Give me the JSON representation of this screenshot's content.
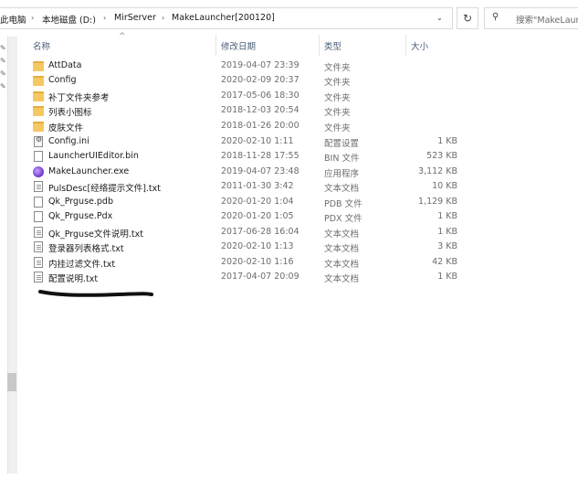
{
  "address": {
    "breadcrumbs": [
      "此电脑",
      "本地磁盘 (D:)",
      "MirServer",
      "MakeLauncher[200120]"
    ]
  },
  "search": {
    "placeholder": "搜索\"MakeLauncher\""
  },
  "columns": {
    "name": "名称",
    "date": "修改日期",
    "type": "类型",
    "size": "大小"
  },
  "files": [
    {
      "name": "AttData",
      "date": "2019-04-07 23:39",
      "type": "文件夹",
      "size": "",
      "icon": "folder-icon"
    },
    {
      "name": "Config",
      "date": "2020-02-09 20:37",
      "type": "文件夹",
      "size": "",
      "icon": "folder-icon"
    },
    {
      "name": "补丁文件夹参考",
      "date": "2017-05-06 18:30",
      "type": "文件夹",
      "size": "",
      "icon": "folder-icon"
    },
    {
      "name": "列表小图标",
      "date": "2018-12-03 20:54",
      "type": "文件夹",
      "size": "",
      "icon": "folder-icon"
    },
    {
      "name": "皮肤文件",
      "date": "2018-01-26 20:00",
      "type": "文件夹",
      "size": "",
      "icon": "folder-icon"
    },
    {
      "name": "Config.ini",
      "date": "2020-02-10 1:11",
      "type": "配置设置",
      "size": "1 KB",
      "icon": "settings-file-icon"
    },
    {
      "name": "LauncherUIEditor.bin",
      "date": "2018-11-28 17:55",
      "type": "BIN 文件",
      "size": "523 KB",
      "icon": "file-icon"
    },
    {
      "name": "MakeLauncher.exe",
      "date": "2019-04-07 23:48",
      "type": "应用程序",
      "size": "3,112 KB",
      "icon": "app-icon"
    },
    {
      "name": "PulsDesc[经络提示文件].txt",
      "date": "2011-01-30 3:42",
      "type": "文本文档",
      "size": "10 KB",
      "icon": "text-file-icon"
    },
    {
      "name": "Qk_Prguse.pdb",
      "date": "2020-01-20 1:04",
      "type": "PDB 文件",
      "size": "1,129 KB",
      "icon": "file-icon"
    },
    {
      "name": "Qk_Prguse.Pdx",
      "date": "2020-01-20 1:05",
      "type": "PDX 文件",
      "size": "1 KB",
      "icon": "file-icon"
    },
    {
      "name": "Qk_Prguse文件说明.txt",
      "date": "2017-06-28 16:04",
      "type": "文本文档",
      "size": "1 KB",
      "icon": "text-file-icon"
    },
    {
      "name": "登录器列表格式.txt",
      "date": "2020-02-10 1:13",
      "type": "文本文档",
      "size": "3 KB",
      "icon": "text-file-icon"
    },
    {
      "name": "内挂过滤文件.txt",
      "date": "2020-02-10 1:16",
      "type": "文本文档",
      "size": "42 KB",
      "icon": "text-file-icon"
    },
    {
      "name": "配置说明.txt",
      "date": "2017-04-07 20:09",
      "type": "文本文档",
      "size": "1 KB",
      "icon": "text-file-icon"
    }
  ],
  "colors": {
    "folder": "#f5c862",
    "header_text": "#4c607a",
    "border": "#d9d9d9"
  }
}
